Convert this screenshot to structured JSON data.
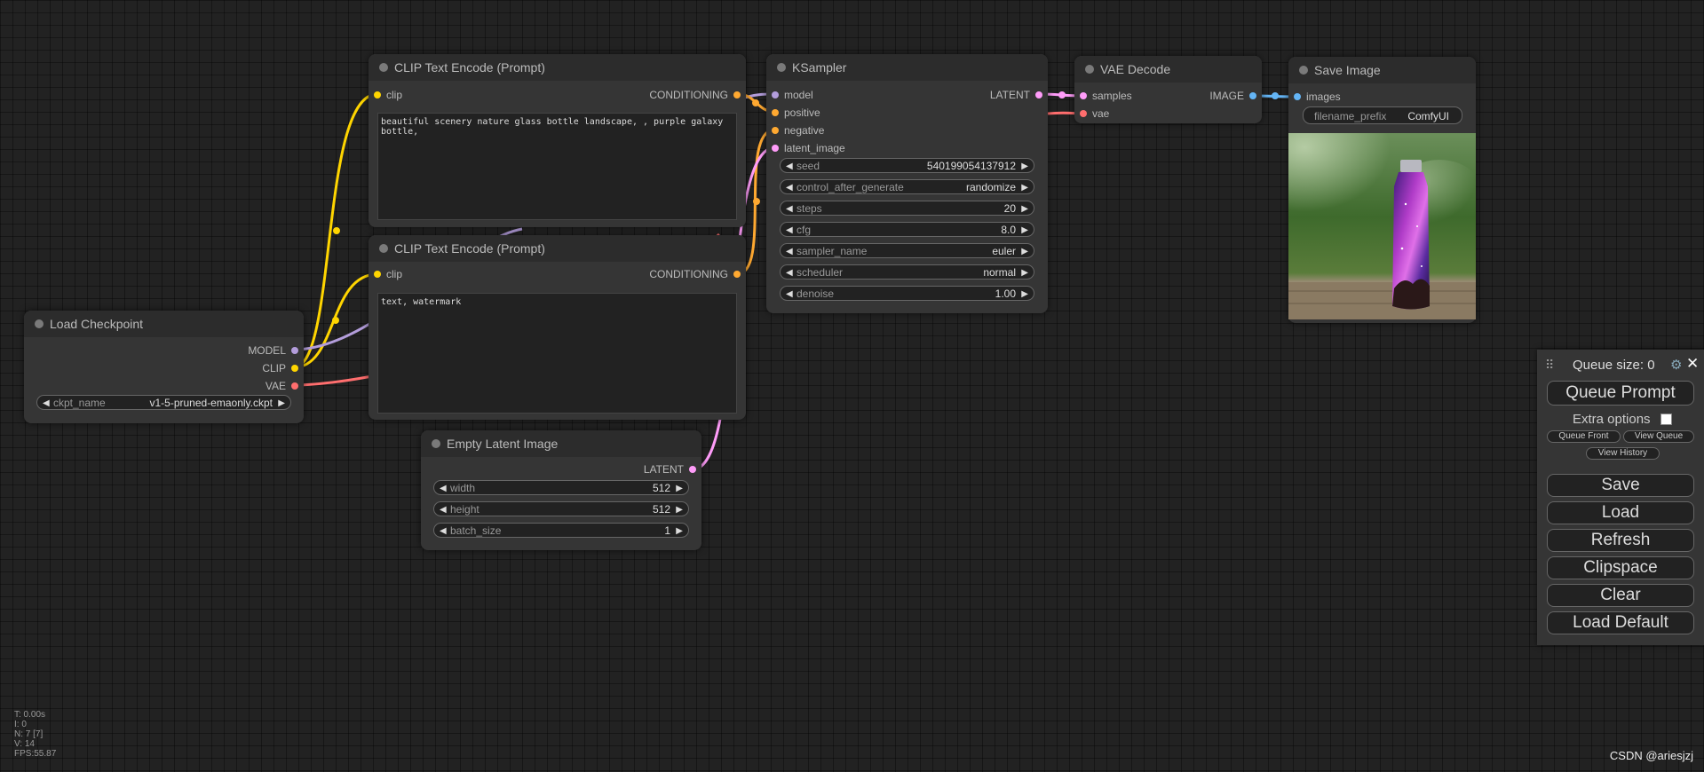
{
  "colors": {
    "model": "#b39ddb",
    "clip": "#ffd500",
    "vae": "#ff6e6e",
    "conditioning": "#ffa931",
    "latent": "#ff9cf9",
    "image": "#64b5f6"
  },
  "nodes": {
    "clip_pos": {
      "title": "CLIP Text Encode (Prompt)",
      "input_clip": "clip",
      "output": "CONDITIONING",
      "text": "beautiful scenery nature glass bottle landscape, , purple galaxy bottle,"
    },
    "clip_neg": {
      "title": "CLIP Text Encode (Prompt)",
      "input_clip": "clip",
      "output": "CONDITIONING",
      "text": "text, watermark"
    },
    "ksampler": {
      "title": "KSampler",
      "inputs": {
        "model": "model",
        "positive": "positive",
        "negative": "negative",
        "latent_image": "latent_image"
      },
      "output": "LATENT",
      "widgets": [
        {
          "name": "seed",
          "value": "540199054137912"
        },
        {
          "name": "control_after_generate",
          "value": "randomize"
        },
        {
          "name": "steps",
          "value": "20"
        },
        {
          "name": "cfg",
          "value": "8.0"
        },
        {
          "name": "sampler_name",
          "value": "euler"
        },
        {
          "name": "scheduler",
          "value": "normal"
        },
        {
          "name": "denoise",
          "value": "1.00"
        }
      ]
    },
    "vae_decode": {
      "title": "VAE Decode",
      "input_samples": "samples",
      "input_vae": "vae",
      "output": "IMAGE"
    },
    "save_image": {
      "title": "Save Image",
      "input_images": "images",
      "widget_name": "filename_prefix",
      "widget_value": "ComfyUI"
    },
    "load_checkpoint": {
      "title": "Load Checkpoint",
      "out_model": "MODEL",
      "out_clip": "CLIP",
      "out_vae": "VAE",
      "widget_name": "ckpt_name",
      "widget_value": "v1-5-pruned-emaonly.ckpt"
    },
    "empty_latent": {
      "title": "Empty Latent Image",
      "output": "LATENT",
      "widgets": [
        {
          "name": "width",
          "value": "512"
        },
        {
          "name": "height",
          "value": "512"
        },
        {
          "name": "batch_size",
          "value": "1"
        }
      ]
    }
  },
  "menu": {
    "queue_size": "Queue size: 0",
    "queue_prompt": "Queue Prompt",
    "extra_options": "Extra options",
    "queue_front": "Queue Front",
    "view_queue": "View Queue",
    "view_history": "View History",
    "save": "Save",
    "load": "Load",
    "refresh": "Refresh",
    "clipspace": "Clipspace",
    "clear": "Clear",
    "load_default": "Load Default"
  },
  "stats": {
    "t": "T: 0.00s",
    "i": "I: 0",
    "n": "N: 7 [7]",
    "v": "V: 14",
    "fps": "FPS:55.87"
  },
  "watermark": "CSDN @ariesjzj"
}
